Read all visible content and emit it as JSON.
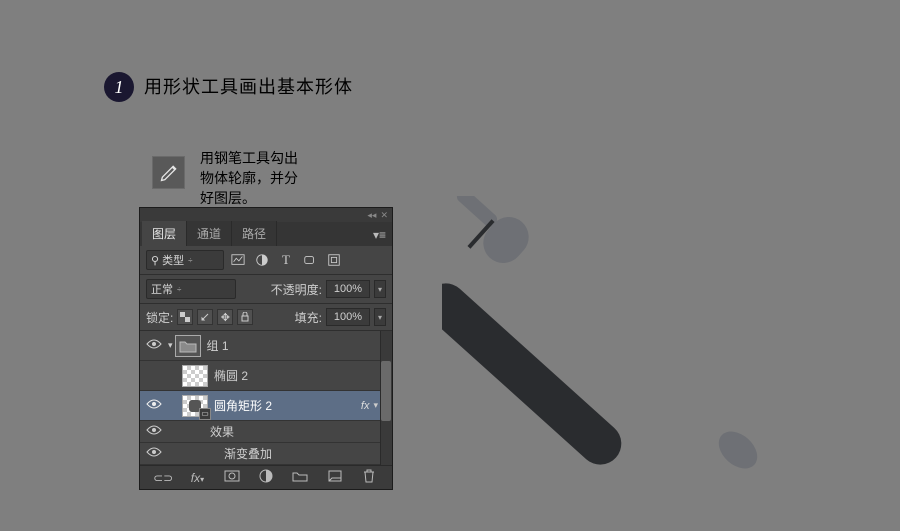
{
  "step": {
    "number": "1",
    "title": "用形状工具画出基本形体"
  },
  "pen_note": {
    "line1": "用钢笔工具勾出",
    "line2": "物体轮廓，并分",
    "line3": "好图层。"
  },
  "panel": {
    "tabs": [
      "图层",
      "通道",
      "路径"
    ],
    "kind": {
      "icon": "⚲",
      "label": "类型",
      "arrow": "÷"
    },
    "blend": {
      "mode": "正常",
      "opacity_label": "不透明度:",
      "opacity_value": "100%"
    },
    "lock": {
      "label": "锁定:",
      "fill_label": "填充:",
      "fill_value": "100%"
    },
    "layers": {
      "group": "组 1",
      "ellipse": "椭圆 2",
      "roundrect": "圆角矩形 2",
      "fx": "fx",
      "effects_label": "效果",
      "gradient_overlay": "渐变叠加"
    }
  }
}
